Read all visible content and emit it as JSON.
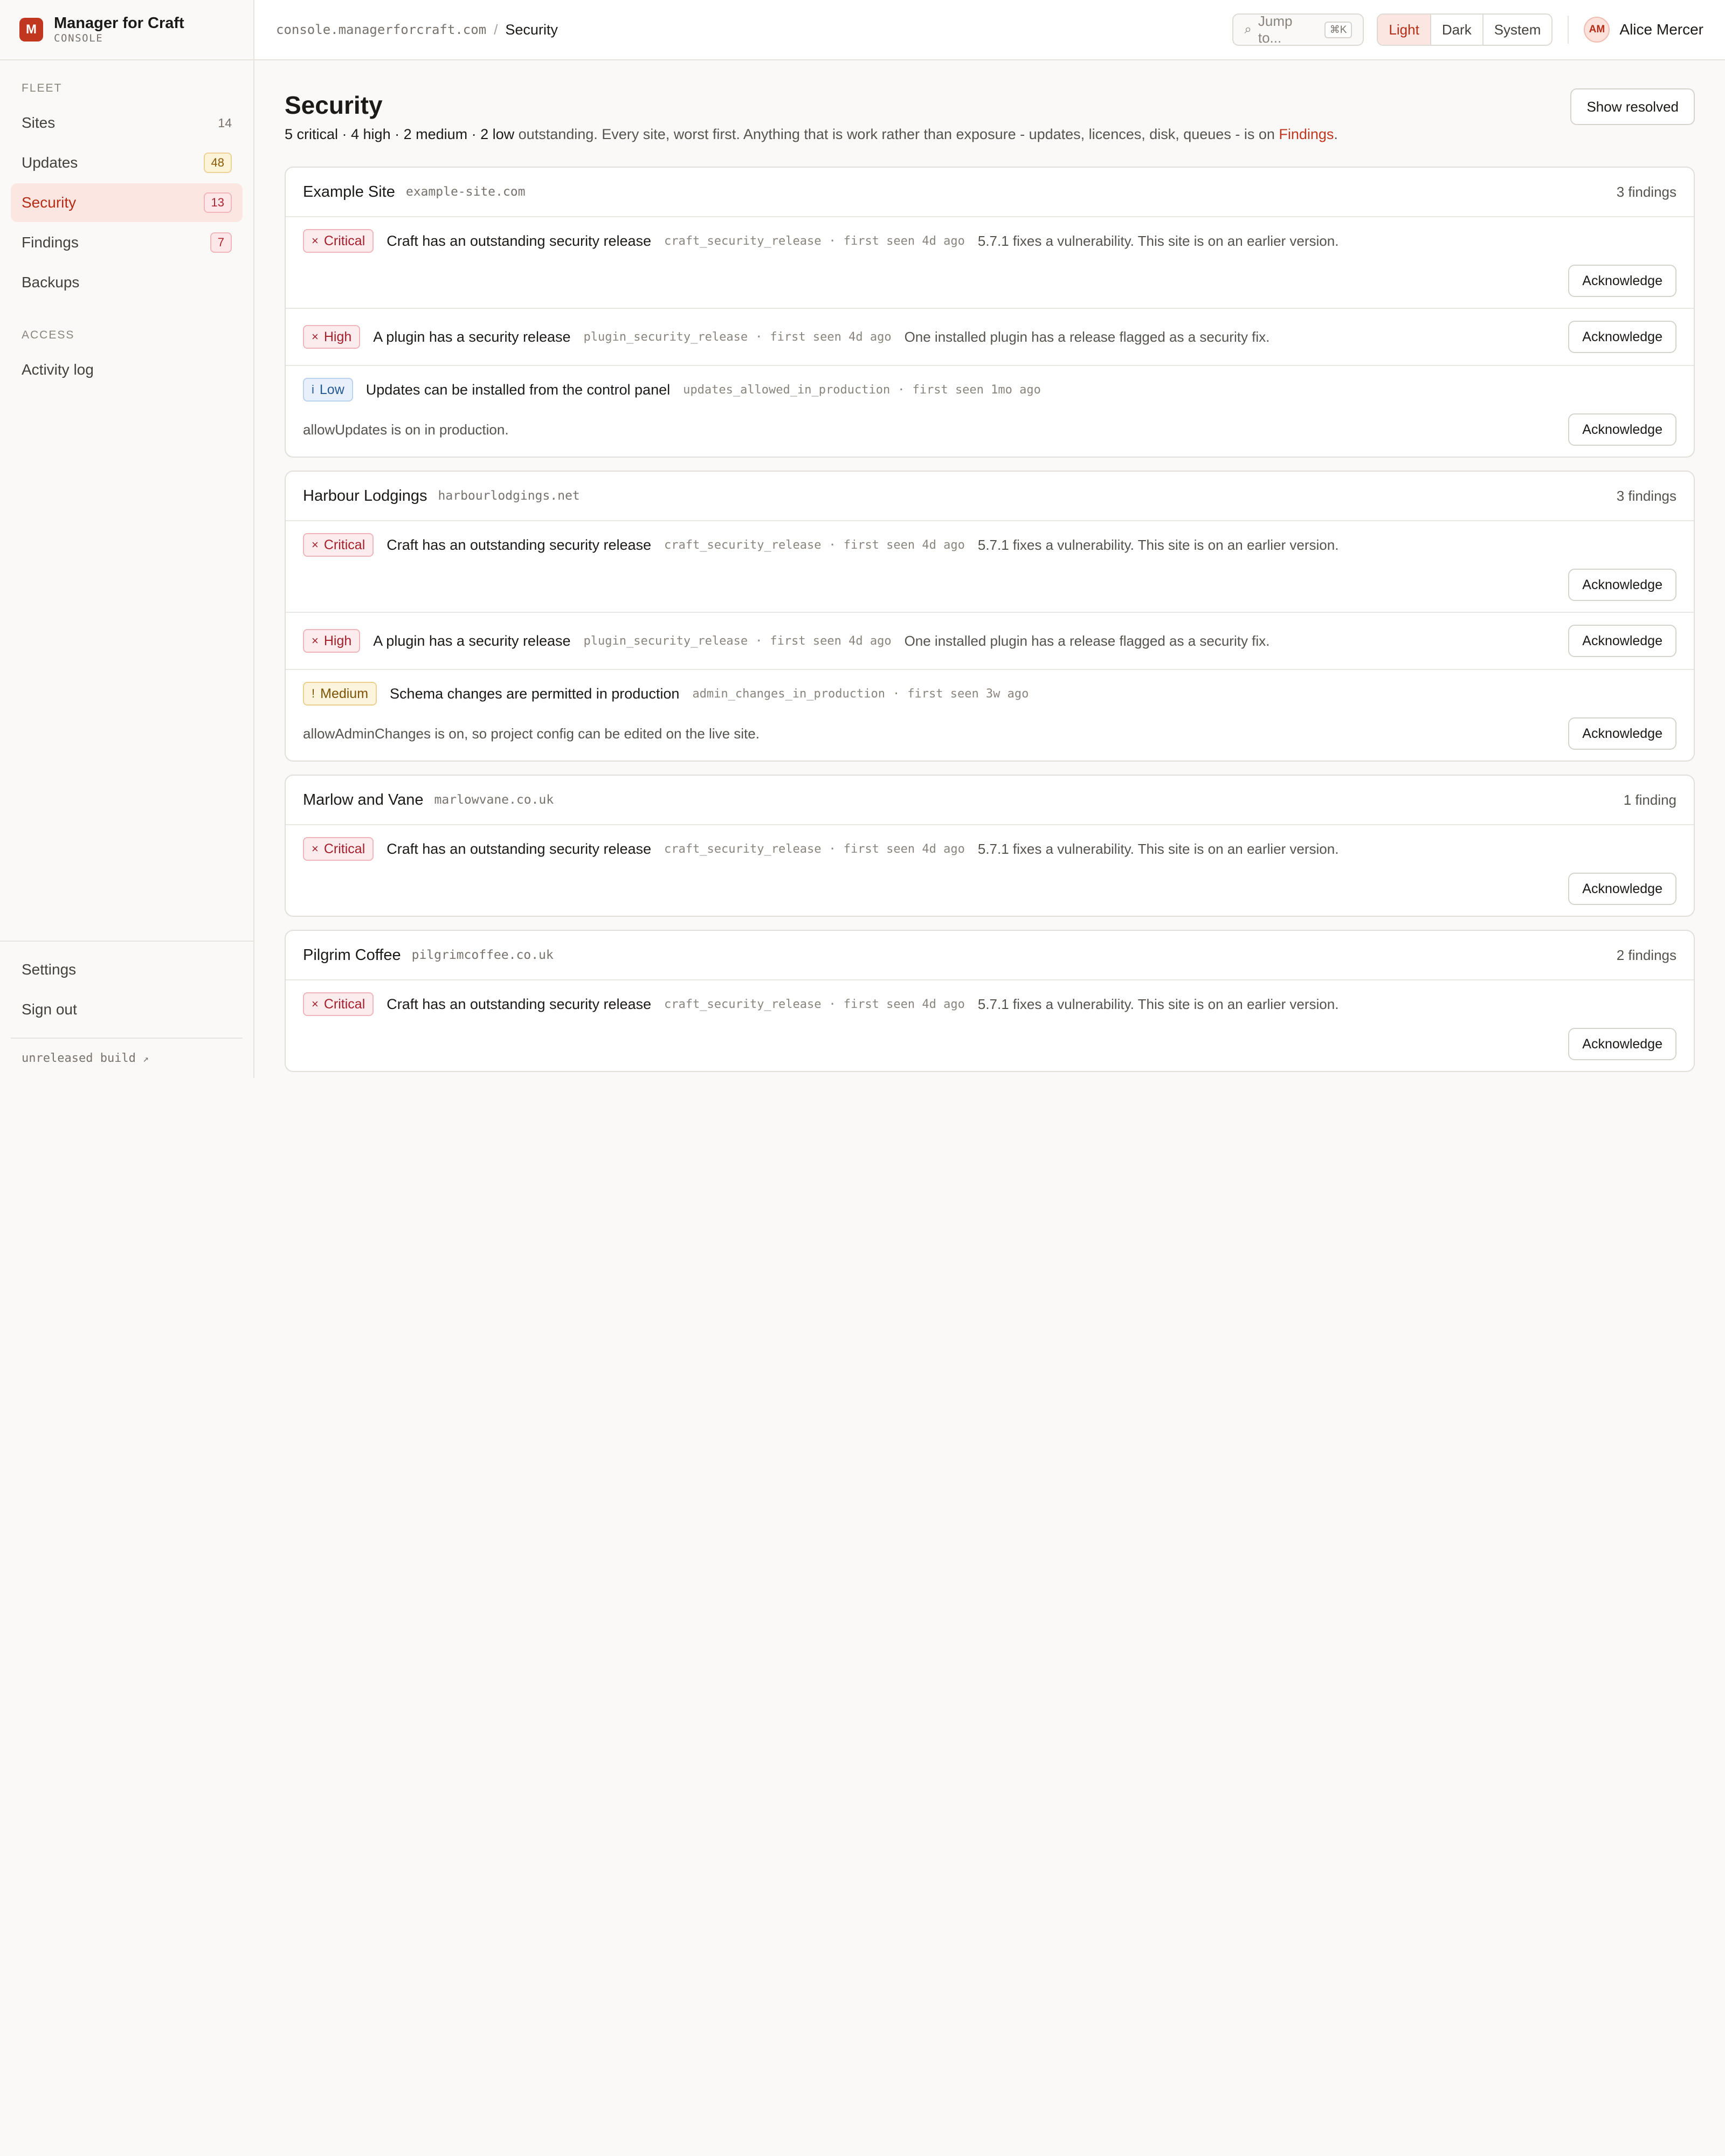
{
  "brand": {
    "logo_letter": "M",
    "name": "Manager for Craft",
    "sub": "CONSOLE"
  },
  "sidebar": {
    "fleet_heading": "FLEET",
    "fleet_items": [
      {
        "label": "Sites",
        "count": "14",
        "count_style": "plain",
        "active": false
      },
      {
        "label": "Updates",
        "count": "48",
        "count_style": "amber",
        "active": false
      },
      {
        "label": "Security",
        "count": "13",
        "count_style": "red",
        "active": true
      },
      {
        "label": "Findings",
        "count": "7",
        "count_style": "red",
        "active": false
      },
      {
        "label": "Backups",
        "count": "",
        "count_style": "none",
        "active": false
      }
    ],
    "access_heading": "ACCESS",
    "access_items": [
      {
        "label": "Activity log"
      }
    ],
    "bottom_items": [
      {
        "label": "Settings"
      },
      {
        "label": "Sign out"
      }
    ],
    "build_label": "unreleased build",
    "build_icon": "external-link-icon"
  },
  "topbar": {
    "host": "console.managerforcraft.com",
    "separator": "/",
    "current": "Security",
    "search_placeholder": "Jump to...",
    "search_icon": "search-icon",
    "search_shortcut": "⌘K",
    "theme_options": [
      "Light",
      "Dark",
      "System"
    ],
    "theme_selected": "Light",
    "user_initials": "AM",
    "user_name": "Alice Mercer"
  },
  "page": {
    "title": "Security",
    "show_resolved_label": "Show resolved",
    "summary_counts": "5 critical · 4 high · 2 medium · 2 low",
    "summary_text": " outstanding. Every site, worst first. Anything that is work rather than exposure - updates, licences, disk, queues - is on ",
    "summary_link": "Findings",
    "summary_end": "."
  },
  "sites": [
    {
      "name": "Example Site",
      "domain": "example-site.com",
      "count_label": "3 findings",
      "findings": [
        {
          "severity": "critical",
          "severity_symbol": "×",
          "severity_label": "Critical",
          "title": "Craft has an outstanding security release",
          "code": "craft_security_release",
          "seen": "first seen 4d ago",
          "description": "5.7.1 fixes a vulnerability. This site is on an earlier version.",
          "layout": "desc-inline-button-below"
        },
        {
          "severity": "high",
          "severity_symbol": "×",
          "severity_label": "High",
          "title": "A plugin has a security release",
          "code": "plugin_security_release",
          "seen": "first seen 4d ago",
          "description": "One installed plugin has a release flagged as a security fix.",
          "layout": "inline"
        },
        {
          "severity": "low",
          "severity_symbol": "i",
          "severity_label": "Low",
          "title": "Updates can be installed from the control panel",
          "code": "updates_allowed_in_production",
          "seen": "first seen 1mo ago",
          "description": "allowUpdates is on in production.",
          "layout": "desc-below"
        }
      ]
    },
    {
      "name": "Harbour Lodgings",
      "domain": "harbourlodgings.net",
      "count_label": "3 findings",
      "findings": [
        {
          "severity": "critical",
          "severity_symbol": "×",
          "severity_label": "Critical",
          "title": "Craft has an outstanding security release",
          "code": "craft_security_release",
          "seen": "first seen 4d ago",
          "description": "5.7.1 fixes a vulnerability. This site is on an earlier version.",
          "layout": "desc-inline-button-below"
        },
        {
          "severity": "high",
          "severity_symbol": "×",
          "severity_label": "High",
          "title": "A plugin has a security release",
          "code": "plugin_security_release",
          "seen": "first seen 4d ago",
          "description": "One installed plugin has a release flagged as a security fix.",
          "layout": "inline"
        },
        {
          "severity": "medium",
          "severity_symbol": "!",
          "severity_label": "Medium",
          "title": "Schema changes are permitted in production",
          "code": "admin_changes_in_production",
          "seen": "first seen 3w ago",
          "description": "allowAdminChanges is on, so project config can be edited on the live site.",
          "layout": "desc-below"
        }
      ]
    },
    {
      "name": "Marlow and Vane",
      "domain": "marlowvane.co.uk",
      "count_label": "1 finding",
      "findings": [
        {
          "severity": "critical",
          "severity_symbol": "×",
          "severity_label": "Critical",
          "title": "Craft has an outstanding security release",
          "code": "craft_security_release",
          "seen": "first seen 4d ago",
          "description": "5.7.1 fixes a vulnerability. This site is on an earlier version.",
          "layout": "desc-inline-button-below"
        }
      ]
    },
    {
      "name": "Pilgrim Coffee",
      "domain": "pilgrimcoffee.co.uk",
      "count_label": "2 findings",
      "findings": [
        {
          "severity": "critical",
          "severity_symbol": "×",
          "severity_label": "Critical",
          "title": "Craft has an outstanding security release",
          "code": "craft_security_release",
          "seen": "first seen 4d ago",
          "description": "5.7.1 fixes a vulnerability. This site is on an earlier version.",
          "layout": "desc-inline-button-below"
        }
      ]
    }
  ],
  "acknowledge_label": "Acknowledge",
  "meta_separator": "·"
}
